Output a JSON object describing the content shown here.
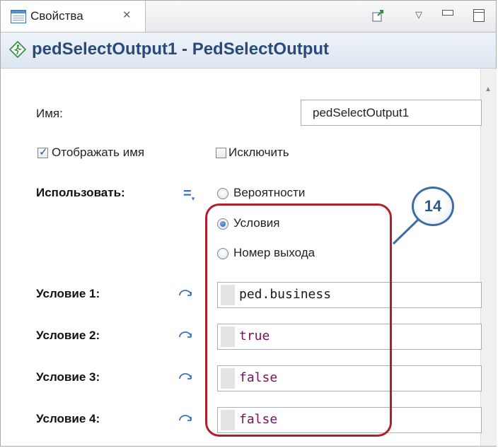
{
  "tab": {
    "label": "Свойства",
    "close_icon": "close-icon"
  },
  "header": {
    "title": "pedSelectOutput1 - PedSelectOutput",
    "icon": "pedestrian-block-icon"
  },
  "name_field": {
    "label": "Имя:",
    "value": "pedSelectOutput1"
  },
  "checkboxes": [
    {
      "label": "Отображать имя",
      "checked": true
    },
    {
      "label": "Исключить",
      "checked": false
    }
  ],
  "use": {
    "label": "Использовать:",
    "options": [
      {
        "label": "Вероятности",
        "selected": false
      },
      {
        "label": "Условия",
        "selected": true
      },
      {
        "label": "Номер выхода",
        "selected": false
      }
    ]
  },
  "conditions": [
    {
      "label": "Условие 1:",
      "value": "ped.business",
      "color": "#1a1a1a"
    },
    {
      "label": "Условие 2:",
      "value": "true",
      "color": "#7a0f5c"
    },
    {
      "label": "Условие 3:",
      "value": "false",
      "color": "#7a0f5c"
    },
    {
      "label": "Условие 4:",
      "value": "false",
      "color": "#7a0f5c"
    }
  ],
  "callout": {
    "number": "14"
  },
  "colors": {
    "highlight": "#b0202a",
    "accent": "#3e6da6",
    "keyword": "#7a0f5c",
    "title": "#2a4a7a"
  }
}
